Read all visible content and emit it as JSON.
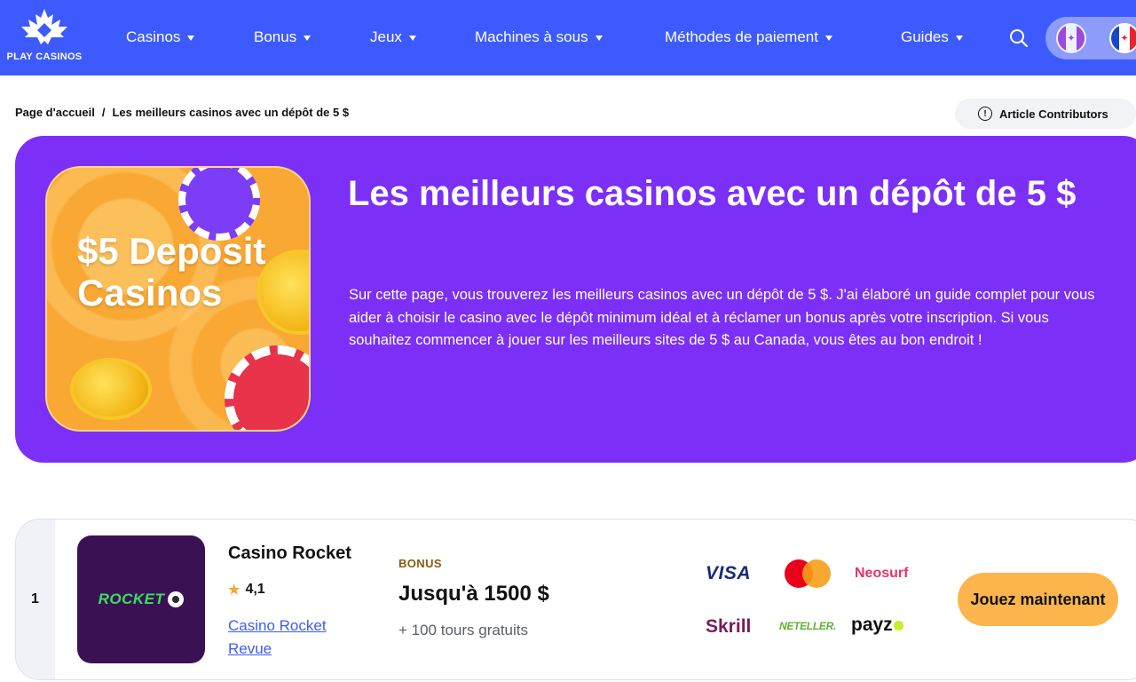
{
  "nav": {
    "logo_text": "PLAY CASINOS",
    "items": [
      {
        "label": "Casinos"
      },
      {
        "label": "Bonus"
      },
      {
        "label": "Jeux"
      },
      {
        "label": "Machines à sous"
      },
      {
        "label": "Méthodes de paiement"
      },
      {
        "label": "Guides"
      }
    ],
    "search_icon": "search-icon",
    "brand_color": "#3d5afe"
  },
  "breadcrumb": {
    "home": "Page d'accueil",
    "separator": "/",
    "current": "Les meilleurs casinos avec un dépôt de 5 $"
  },
  "contributors": {
    "label": "Article Contributors"
  },
  "hero": {
    "title": "Les meilleurs casinos avec un dépôt de 5 $",
    "description": "Sur cette page, vous trouverez les meilleurs casinos avec un dépôt de 5 $. J'ai élaboré un guide complet pour vous aider à choisir le casino avec le dépôt minimum idéal et à réclamer un bonus après votre inscription. Si vous souhaitez commencer à jouer sur les meilleurs sites de 5 $ au Canada, vous êtes au bon endroit !",
    "image_text": "$5 Deposit Casinos",
    "bg_color": "#7b2ff7"
  },
  "casino": {
    "rank": "1",
    "logo_text": "ROCKET",
    "name": "Casino Rocket",
    "rating": "4,1",
    "review_link": "Casino Rocket Revue",
    "bonus_label": "BONUS",
    "bonus_value": "Jusqu'à 1500 $",
    "bonus_extra": "+ 100 tours gratuits",
    "payments": {
      "visa": "VISA",
      "mastercard": "mastercard-icon",
      "neosurf": "Neosurf",
      "skrill": "Skrill",
      "neteller": "NETELLER.",
      "payz": "payz"
    },
    "cta": "Jouez maintenant",
    "cta_color": "#fbb54c"
  }
}
